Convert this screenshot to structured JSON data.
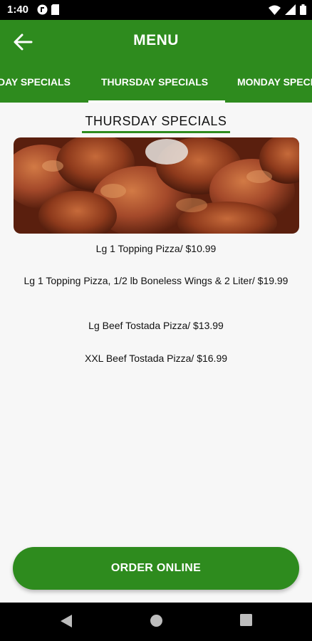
{
  "status_bar": {
    "time": "1:40",
    "icons_left": [
      "notification-app-icon",
      "sim-card-icon"
    ],
    "icons_right": [
      "wifi-icon",
      "signal-icon",
      "battery-icon"
    ]
  },
  "app_bar": {
    "title": "MENU",
    "back_icon": "arrow-left-icon",
    "background": "#2e8b1e"
  },
  "tabs": {
    "items": [
      {
        "label": "DAY SPECIALS"
      },
      {
        "label": "THURSDAY SPECIALS"
      },
      {
        "label": "MONDAY SPECIALS"
      }
    ],
    "active_index": 1
  },
  "section": {
    "title": "THURSDAY SPECIALS"
  },
  "hero": {
    "subject": "chicken wings"
  },
  "menu_items": [
    {
      "text": "Lg 1 Topping Pizza/ $10.99"
    },
    {
      "text": "Lg 1 Topping Pizza, 1/2 lb Boneless Wings & 2 Liter/ $19.99"
    },
    {
      "text": "Lg Beef Tostada Pizza/ $13.99"
    },
    {
      "text": "XXL Beef Tostada Pizza/ $16.99"
    }
  ],
  "order_button": {
    "label": "ORDER ONLINE"
  },
  "nav_bar": {
    "buttons": [
      "back-triangle-icon",
      "home-circle-icon",
      "recents-square-icon"
    ]
  },
  "colors": {
    "accent": "#2e8b1e",
    "page_background": "#f7f7f7",
    "text": "#111111"
  }
}
